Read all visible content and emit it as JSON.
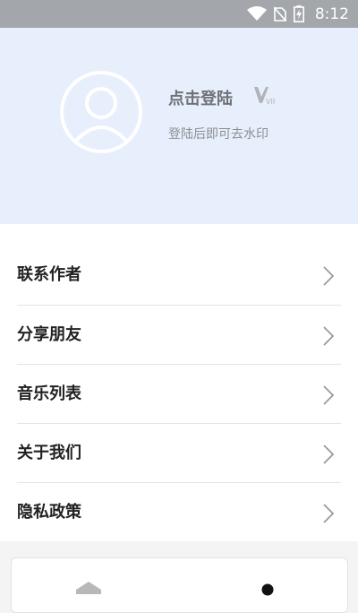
{
  "status_bar": {
    "time": "8:12",
    "icons": [
      "wifi-icon",
      "no-sim-icon",
      "battery-charging-icon"
    ]
  },
  "profile": {
    "login_title": "点击登陆",
    "login_subtitle": "登陆后即可去水印",
    "vip_badge": "VIP",
    "avatar_icon": "user-avatar-icon"
  },
  "menu": {
    "items": [
      {
        "label": "联系作者",
        "icon": "chevron-right-icon"
      },
      {
        "label": "分享朋友",
        "icon": "chevron-right-icon"
      },
      {
        "label": "音乐列表",
        "icon": "chevron-right-icon"
      },
      {
        "label": "关于我们",
        "icon": "chevron-right-icon"
      },
      {
        "label": "隐私政策",
        "icon": "chevron-right-icon"
      }
    ]
  },
  "bottom_nav": {
    "items": [
      "home-icon",
      "profile-icon"
    ]
  },
  "colors": {
    "status_bar": "#a3a6ab",
    "header_bg": "#e8effc",
    "menu_bg": "#ffffff",
    "page_bg": "#f4f4f4"
  }
}
